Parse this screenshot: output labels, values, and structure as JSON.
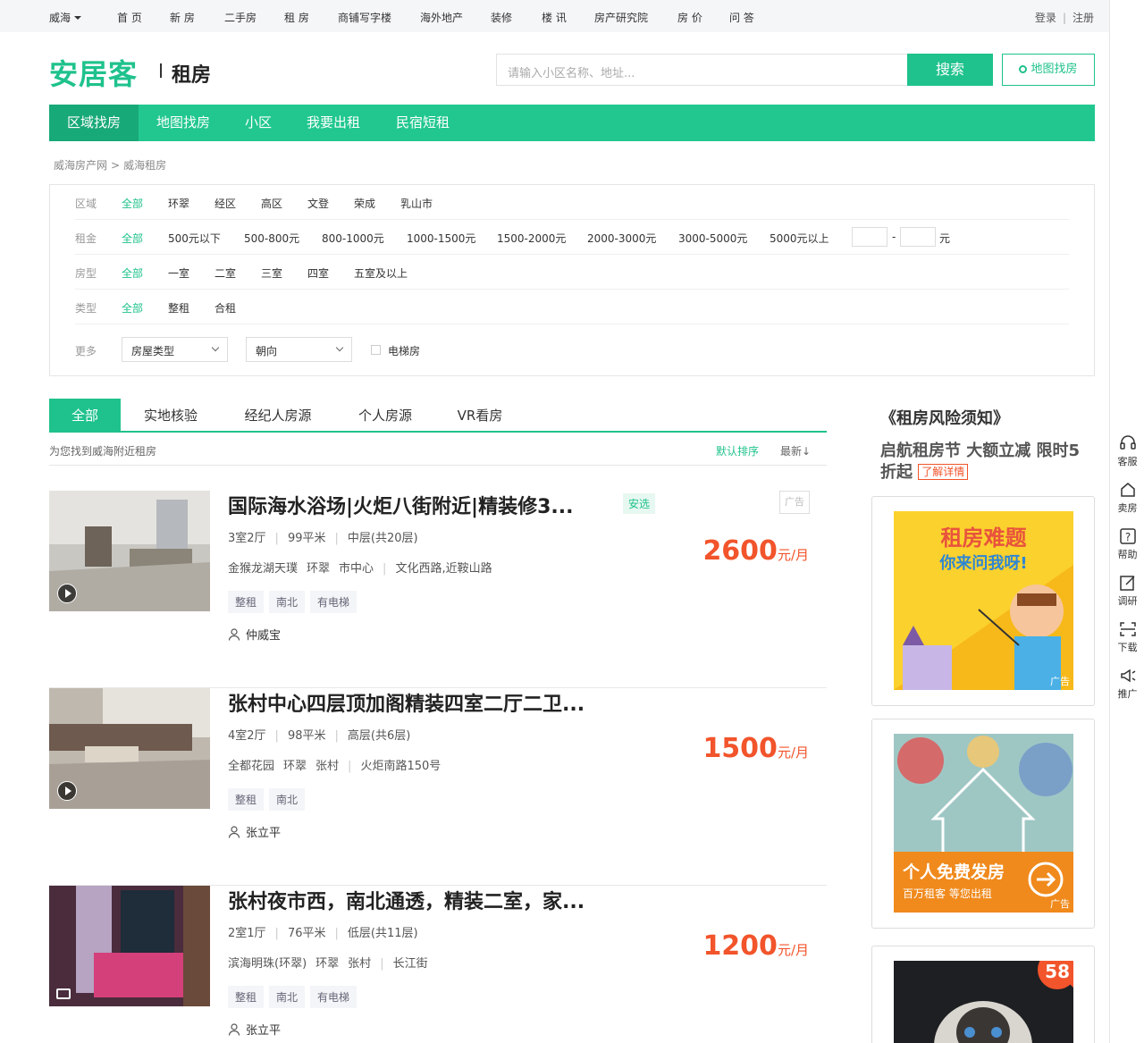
{
  "topbar": {
    "city": "威海",
    "nav": [
      "首 页",
      "新 房",
      "二手房",
      "租 房",
      "商铺写字楼",
      "海外地产",
      "装修",
      "楼 讯",
      "房产研究院",
      "房 价",
      "问 答"
    ],
    "login": "登录",
    "register": "注册"
  },
  "header": {
    "logo": "安居客",
    "section": "租房",
    "search_placeholder": "请输入小区名称、地址...",
    "search_button": "搜索",
    "map_button": "地图找房"
  },
  "mainnav": [
    "区域找房",
    "地图找房",
    "小区",
    "我要出租",
    "民宿短租"
  ],
  "breadcrumb": [
    "威海房产网",
    "威海租房"
  ],
  "filters": {
    "area": {
      "label": "区域",
      "options": [
        "全部",
        "环翠",
        "经区",
        "高区",
        "文登",
        "荣成",
        "乳山市"
      ]
    },
    "rent": {
      "label": "租金",
      "options": [
        "全部",
        "500元以下",
        "500-800元",
        "800-1000元",
        "1000-1500元",
        "1500-2000元",
        "2000-3000元",
        "3000-5000元",
        "5000元以上"
      ],
      "range_sep": "-",
      "unit": "元"
    },
    "layout": {
      "label": "房型",
      "options": [
        "全部",
        "一室",
        "二室",
        "三室",
        "四室",
        "五室及以上"
      ]
    },
    "type": {
      "label": "类型",
      "options": [
        "全部",
        "整租",
        "合租"
      ]
    },
    "more": {
      "label": "更多",
      "house_type": "房屋类型",
      "orientation": "朝向",
      "elevator": "电梯房"
    }
  },
  "tabs": [
    "全部",
    "实地核验",
    "经纪人房源",
    "个人房源",
    "VR看房"
  ],
  "subhead": {
    "text": "为您找到威海附近租房",
    "sort_default": "默认排序",
    "sort_new": "最新"
  },
  "listings": [
    {
      "title": "国际海水浴场|火炬八街附近|精装修3...",
      "badge": "安选",
      "ad": "广告",
      "rooms": "3室2厅",
      "size": "99平米",
      "floor": "中层(共20层)",
      "community": "金猴龙湖天璞",
      "district": "环翠",
      "area": "市中心",
      "road": "文化西路,近鞍山路",
      "tags": [
        "整租",
        "南北",
        "有电梯"
      ],
      "agent": "仲威宝",
      "price": "2600",
      "unit": "元/月"
    },
    {
      "title": "张村中心四层顶加阁精装四室二厅二卫...",
      "rooms": "4室2厅",
      "size": "98平米",
      "floor": "高层(共6层)",
      "community": "全都花园",
      "district": "环翠",
      "area": "张村",
      "road": "火炬南路150号",
      "tags": [
        "整租",
        "南北"
      ],
      "agent": "张立平",
      "price": "1500",
      "unit": "元/月"
    },
    {
      "title": "张村夜市西，南北通透，精装二室，家...",
      "rooms": "2室1厅",
      "size": "76平米",
      "floor": "低层(共11层)",
      "community": "滨海明珠(环翠)",
      "district": "环翠",
      "area": "张村",
      "road": "长江街",
      "tags": [
        "整租",
        "南北",
        "有电梯"
      ],
      "agent": "张立平",
      "price": "1200",
      "unit": "元/月"
    }
  ],
  "sidebar": {
    "notice": "《租房风险须知》",
    "promo": "启航租房节 大额立减 限时5折起",
    "promo_more": "了解详情",
    "ad1": {
      "line1": "租房难题",
      "line2": "你来问我呀!",
      "label": "广告"
    },
    "ad2": {
      "line1": "个人免费发房",
      "line2": "百万租客 等您出租",
      "label": "广告"
    },
    "ad3": {
      "badge": "58"
    }
  },
  "rightbar": [
    "客服",
    "卖房",
    "帮助",
    "调研",
    "下载",
    "推广"
  ],
  "colors": {
    "brand": "#1fc28c",
    "price": "#f2542b"
  }
}
